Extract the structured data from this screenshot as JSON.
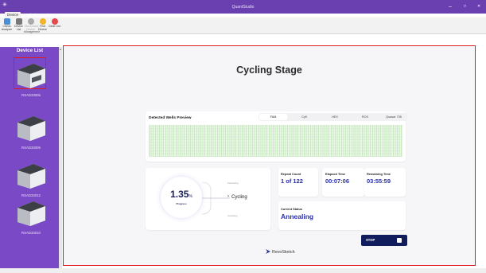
{
  "window": {
    "title": "QuantStudio",
    "minimize_glyph": "–",
    "maximize_glyph": "□",
    "close_glyph": "✕"
  },
  "menu_tabs": [
    "Device",
    "Analysis",
    "Option"
  ],
  "ribbon": {
    "buttons": [
      {
        "label": "Check Analyzer",
        "icon": "check-analyzer-icon",
        "color": "#4a8fd6"
      },
      {
        "label": "Device List",
        "icon": "device-list-icon",
        "color": "#777777"
      },
      {
        "label": "Disconnect Device",
        "icon": "disconnect-device-icon",
        "color": "#8a8a8a"
      },
      {
        "label": "Find Device",
        "icon": "find-device-icon",
        "color": "#f0b429"
      },
      {
        "label": "Clear List",
        "icon": "clear-list-icon",
        "color": "#e5484d"
      }
    ],
    "group_label": "Management"
  },
  "sidebar": {
    "title": "Device List",
    "devices": [
      {
        "label": "RSAD33006",
        "selected": true
      },
      {
        "label": "RSAD33005",
        "selected": false
      },
      {
        "label": "RSAD33012",
        "selected": false
      },
      {
        "label": "RSAD33010",
        "selected": false
      }
    ]
  },
  "main": {
    "title": "Cycling Stage",
    "wells": {
      "title": "Detected Wells Preview",
      "filters": [
        "FAM",
        "Cy5",
        "HEX",
        "ROX",
        "Quasar 705"
      ],
      "active_filter": "FAM"
    },
    "progress": {
      "value": "1.35",
      "unit": "%",
      "label": "Progress",
      "previous_step": "Preheating",
      "current_step": "Cycling",
      "next_step": "Annealing"
    },
    "stats": {
      "repeat_count_label": "Repeat Count",
      "repeat_count_value": "1 of 122",
      "elapsed_label": "Elapsed Time",
      "elapsed_value": "00:07:06",
      "remaining_label": "Remaining Time",
      "remaining_value": "03:55:59"
    },
    "status": {
      "label": "Current Status",
      "value": "Annealing"
    },
    "stop_label": "STOP",
    "brand": "RevoSketch"
  },
  "colors": {
    "titlebar": "#6a3fb0",
    "sidebar": "#7a49c6",
    "accent_blue": "#2a2fa8",
    "stop_button": "#111c5c",
    "selection_frame": "#e01a22"
  }
}
